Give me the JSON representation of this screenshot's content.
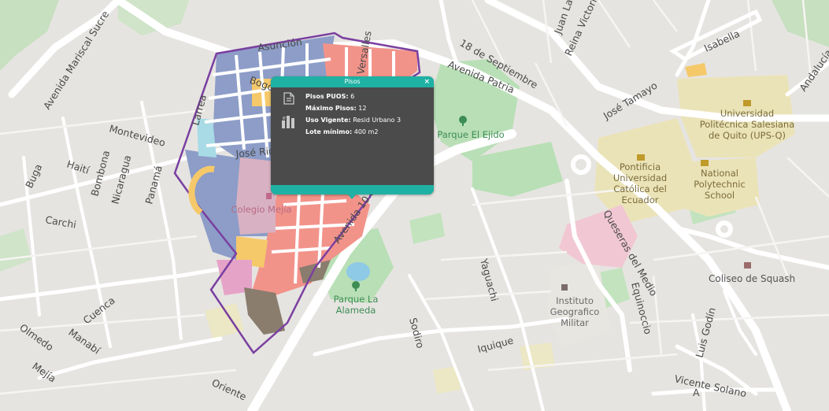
{
  "colors": {
    "background": "#e6e4e1",
    "park": "#b9dfb6",
    "campus": "#ebe3b8",
    "pink_zone": "#f1c7d3",
    "zone_blue": "#8d9dc8",
    "zone_red": "#f2938a",
    "zone_yellow": "#f5c96a",
    "zone_cyan": "#a8dbe6",
    "zone_pink": "#e6a3c8",
    "zone_dark": "#8a7d6e",
    "boundary": "#7a3fa0",
    "popup_accent": "#1fb1a3",
    "popup_body": "#4b4b4b"
  },
  "streets": {
    "avenida_mariscal_sucre": "Avenida Mariscal Sucre",
    "asuncion": "Asunción",
    "bogota": "Bogotá",
    "jose_riofrio": "José Riofrío",
    "larrea": "Larrea",
    "versalles": "Versalles",
    "juan_larrea": "Juan Larrea",
    "reina_victoria": "Reina Victoria",
    "dieciocho_septiembre": "18 de Septiembre",
    "avenida_patria": "Avenida Patria",
    "jose_tamayo": "José Tamayo",
    "isabella": "Isabella",
    "andalucia": "Andalucía",
    "montevideo": "Montevideo",
    "haiti": "Haití",
    "buga": "Buga",
    "bombona": "Bombona",
    "nicaragua": "Nicaragua",
    "panama": "Panamá",
    "carchi": "Carchi",
    "cuenca": "Cuenca",
    "olmedo": "Olmedo",
    "manabi": "Manabí",
    "mejia": "Mejía",
    "oriente": "Oriente",
    "avenida_10_agosto": "Avenida 10 de Agosto",
    "queseras_del_medio": "Queseras del Medio",
    "yaguachi": "Yaguachi",
    "equinoccio": "Equinoccio",
    "sodiro": "Sodiro",
    "iquique": "Iquique",
    "luis_godin": "Luis Godín",
    "vicente_solano": "Vicente Solano",
    "letter_a": "A"
  },
  "places": {
    "parque_el_ejido": "Parque El Ejido",
    "colegio_mejia": "Colegio Mejía",
    "parque_la_alameda_1": "Parque La",
    "parque_la_alameda_2": "Alameda",
    "instituto_1": "Instituto",
    "instituto_2": "Geografico",
    "instituto_3": "Militar",
    "pontificia_1": "Pontificia",
    "pontificia_2": "Universidad",
    "pontificia_3": "Católica del",
    "pontificia_4": "Ecuador",
    "ups_1": "Universidad",
    "ups_2": "Politécnica Salesiana",
    "ups_3": "de Quito (UPS-Q)",
    "national_1": "National",
    "national_2": "Polytechnic",
    "national_3": "School",
    "coliseo": "Coliseo de Squash"
  },
  "popup": {
    "title": "Pisos",
    "close": "×",
    "rows": [
      {
        "label": "Pisos PUOS:",
        "value": "6"
      },
      {
        "label": "Máximo Pisos:",
        "value": "12"
      },
      {
        "label": "Uso Vigente:",
        "value": "Resid Urbano 3"
      },
      {
        "label": "Lote mínimo:",
        "value": "400 m2"
      }
    ]
  }
}
